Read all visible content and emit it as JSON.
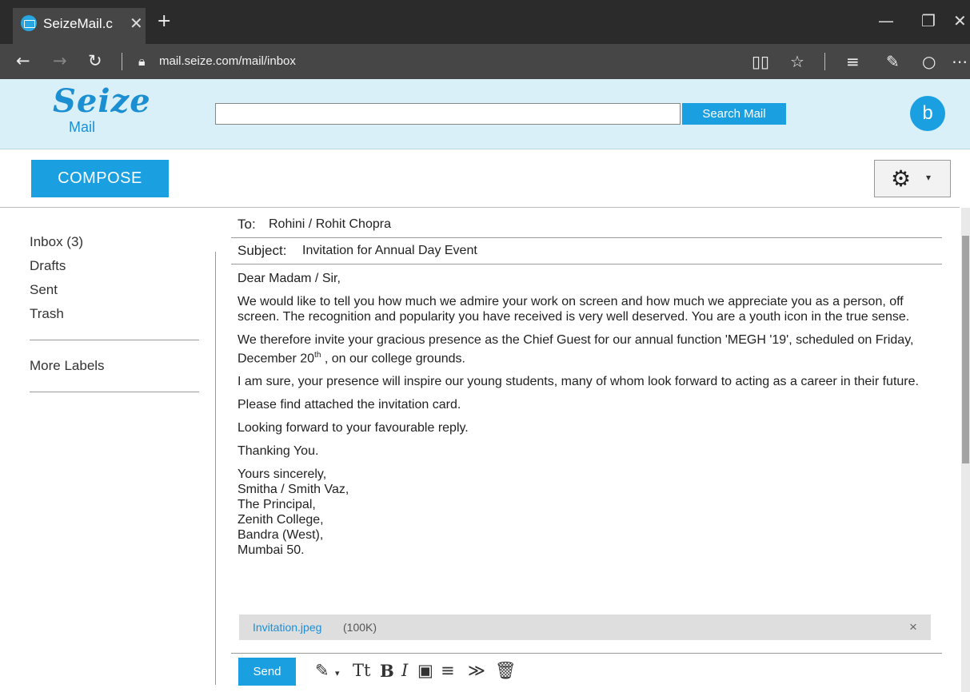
{
  "browser": {
    "tab_title": "SeizeMail.c",
    "tab_close": "✕",
    "new_tab": "+",
    "url": "mail.seize.com/mail/inbox",
    "icons": [
      "back-icon",
      "forward-icon",
      "refresh-icon",
      "lock-icon",
      "reading-view-icon",
      "favorites-icon",
      "hub-icon",
      "web-note-icon",
      "share-icon",
      "more-icon"
    ]
  },
  "header": {
    "logo_word": "Seize",
    "logo_sub": "Mail",
    "search_value": "",
    "search_button": "Search Mail",
    "avatar_letter": "b"
  },
  "toolbar": {
    "compose_label": "COMPOSE",
    "settings_caret": "▾"
  },
  "sidebar": {
    "items": [
      {
        "label": "Inbox (3)"
      },
      {
        "label": "Drafts"
      },
      {
        "label": "Sent"
      },
      {
        "label": "Trash"
      }
    ],
    "more_labels": "More Labels"
  },
  "message": {
    "to_label": "To:",
    "to_value": "Rohini / Rohit Chopra",
    "subject_label": "Subject:",
    "subject_value": "Invitation for Annual Day Event",
    "greeting": "Dear Madam / Sir,",
    "para1": "We would like to tell you how much we admire your work on screen and how much we appreciate you as a person, off screen. The recognition and popularity you have received is very well deserved. You are a youth icon in the true sense.",
    "para2_before": "We therefore invite your gracious presence as the Chief Guest for our annual function 'MEGH '19', scheduled on Friday, December 20",
    "para2_sup": "th",
    "para2_after": " , on our college grounds.",
    "para3": "I am sure, your presence  will inspire our young students, many of whom look forward to acting as a career in their future.",
    "para4": "Please find attached the invitation card.",
    "para5": "Looking forward to your favourable reply.",
    "para6": "Thanking You.",
    "signature": [
      "Yours sincerely,",
      "Smitha / Smith Vaz,",
      "The Principal,",
      "Zenith College,",
      "Bandra (West),",
      "Mumbai 50."
    ]
  },
  "attachment": {
    "name": "Invitation.jpeg",
    "size": "(100K)",
    "remove": "×"
  },
  "compose_bar": {
    "send_label": "Send",
    "tt_label": "Tt",
    "bold_label": "B",
    "italic_label": "I"
  },
  "colors": {
    "accent": "#1a9fe0",
    "header_bg": "#daf0f9",
    "browser_dark": "#2b2b2b",
    "browser_mid": "#464646",
    "attachment_bg": "#dedede"
  }
}
